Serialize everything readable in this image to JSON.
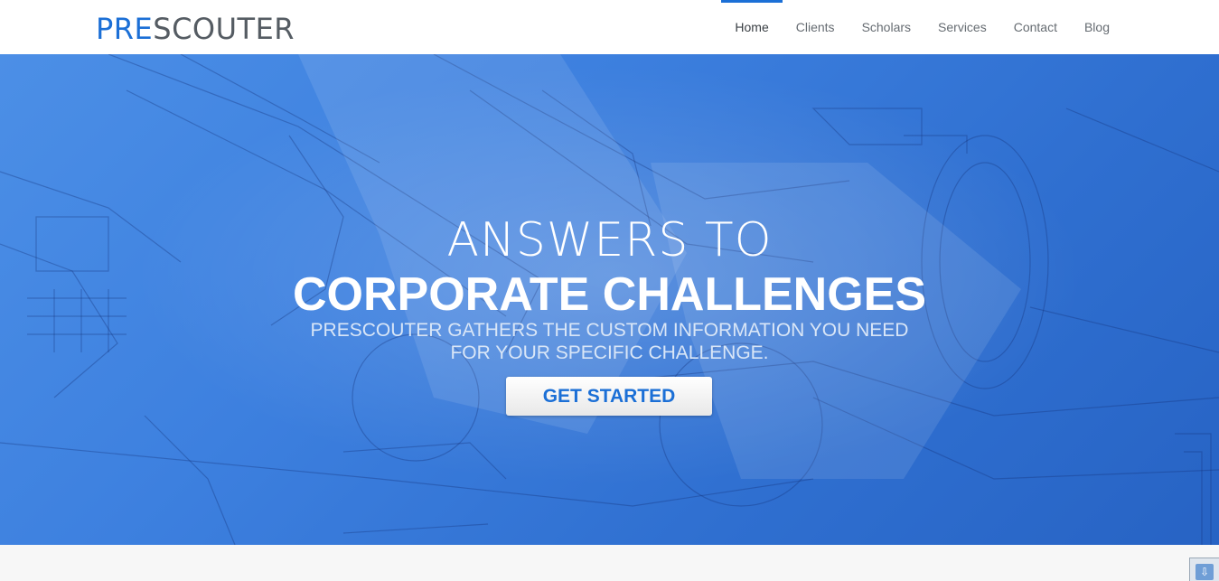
{
  "brand": {
    "prefix": "PRE",
    "suffix": "SCOUTER",
    "accent_color": "#1b6fd6"
  },
  "nav": {
    "items": [
      {
        "label": "Home",
        "active": true
      },
      {
        "label": "Clients",
        "active": false
      },
      {
        "label": "Scholars",
        "active": false
      },
      {
        "label": "Services",
        "active": false
      },
      {
        "label": "Contact",
        "active": false
      },
      {
        "label": "Blog",
        "active": false
      }
    ]
  },
  "hero": {
    "line1": "ANSWERS TO",
    "line2": "CORPORATE CHALLENGES",
    "subtitle_line1": "PRESCOUTER GATHERS THE CUSTOM INFORMATION YOU NEED",
    "subtitle_line2": "FOR YOUR SPECIFIC CHALLENGE.",
    "cta_label": "GET STARTED",
    "background": "blueprint"
  },
  "corner_widget": {
    "icon": "download-arrow-icon"
  }
}
